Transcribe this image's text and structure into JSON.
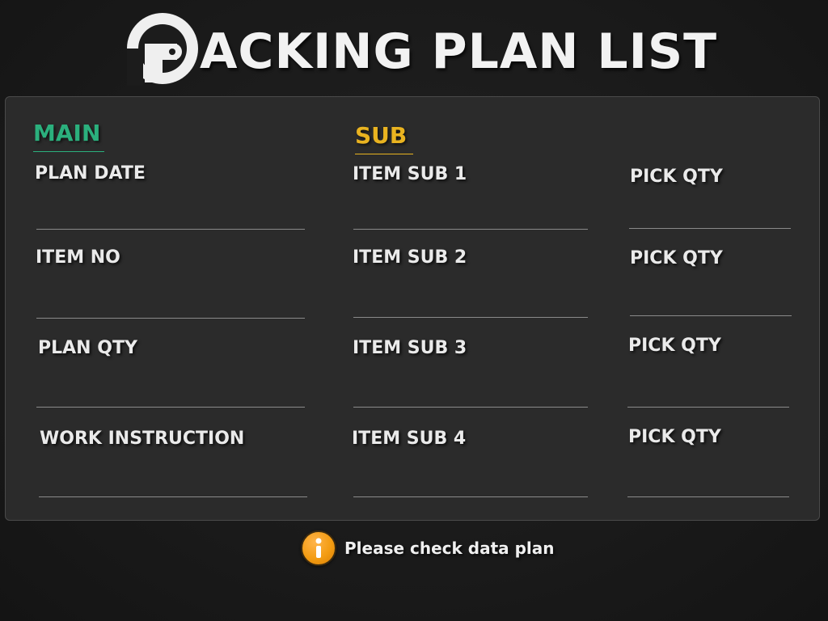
{
  "header": {
    "title_rest": "ACKING PLAN LIST",
    "logo_icon": "p-circle-logo-icon"
  },
  "main": {
    "heading": "MAIN",
    "heading_color": "#2bb07d",
    "fields": [
      {
        "label": "PLAN DATE",
        "value": ""
      },
      {
        "label": "ITEM NO",
        "value": ""
      },
      {
        "label": "PLAN QTY",
        "value": ""
      },
      {
        "label": "WORK INSTRUCTION",
        "value": ""
      }
    ]
  },
  "sub": {
    "heading": "SUB",
    "heading_color": "#e9b320",
    "items": [
      {
        "label": "ITEM SUB 1",
        "value": "",
        "pick_label": "PICK QTY",
        "pick_value": ""
      },
      {
        "label": "ITEM SUB 2",
        "value": "",
        "pick_label": "PICK QTY",
        "pick_value": ""
      },
      {
        "label": "ITEM SUB 3",
        "value": "",
        "pick_label": "PICK QTY",
        "pick_value": ""
      },
      {
        "label": "ITEM SUB 4",
        "value": "",
        "pick_label": "PICK QTY",
        "pick_value": ""
      }
    ]
  },
  "status": {
    "icon": "info-icon",
    "icon_color": "#f39c12",
    "message": "Please check data plan"
  }
}
